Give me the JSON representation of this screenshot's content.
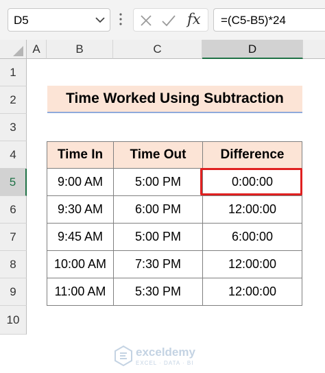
{
  "formula_bar": {
    "name_box": "D5",
    "formula": "=(C5-B5)*24",
    "fx_label": "fx"
  },
  "columns": [
    "A",
    "B",
    "C",
    "D"
  ],
  "rows": [
    "1",
    "2",
    "3",
    "4",
    "5",
    "6",
    "7",
    "8",
    "9",
    "10"
  ],
  "title": "Time Worked Using Subtraction",
  "table": {
    "headers": [
      "Time In",
      "Time Out",
      "Difference"
    ],
    "rows": [
      [
        "9:00 AM",
        "5:00 PM",
        "0:00:00"
      ],
      [
        "9:30 AM",
        "6:00 PM",
        "12:00:00"
      ],
      [
        "9:45 AM",
        "5:00 PM",
        "6:00:00"
      ],
      [
        "10:00 AM",
        "7:30 PM",
        "12:00:00"
      ],
      [
        "11:00 AM",
        "5:30 PM",
        "12:00:00"
      ]
    ]
  },
  "watermark": {
    "brand": "exceldemy",
    "tagline": "EXCEL · DATA · BI"
  },
  "colors": {
    "header_fill": "#fce4d6",
    "highlight": "#e02020",
    "excel_green": "#1e7145"
  }
}
